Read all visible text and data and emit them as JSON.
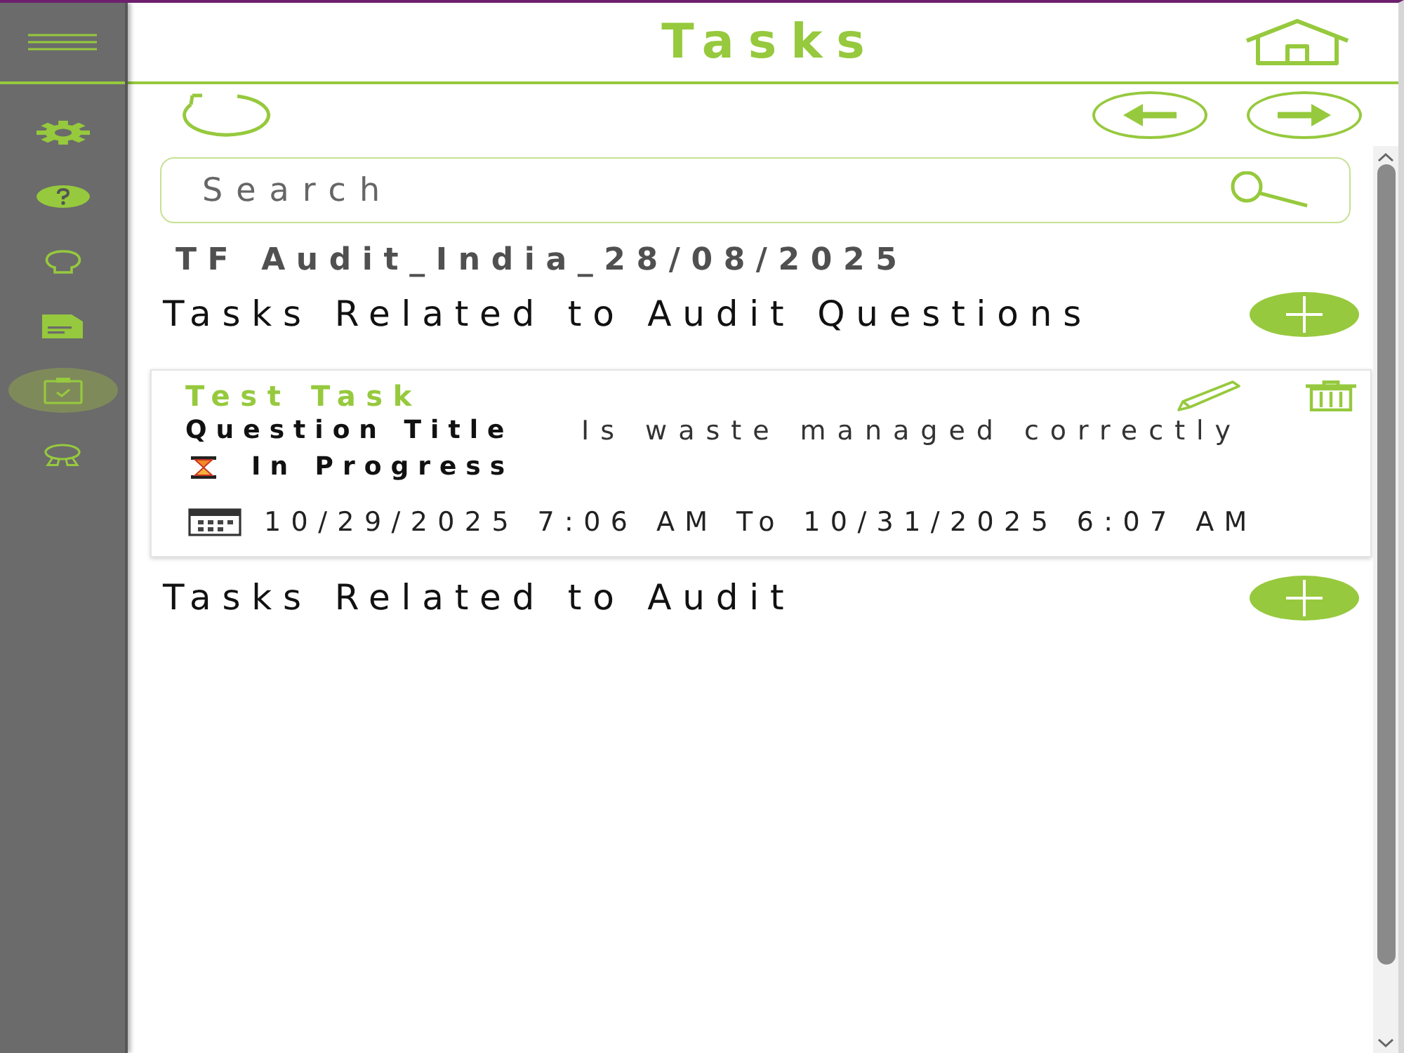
{
  "sidebar": {
    "items": [
      {
        "selected": false
      },
      {
        "selected": false
      },
      {
        "selected": false
      },
      {
        "selected": false
      },
      {
        "selected": true
      },
      {
        "selected": false
      }
    ]
  },
  "header": {
    "title": "Tasks"
  },
  "search": {
    "placeholder": "Search"
  },
  "audit_title": "TF Audit_India_28/08/2025",
  "sections": [
    {
      "heading": "Tasks Related to Audit Questions",
      "tasks": [
        {
          "title": "Test Task",
          "question_label": "Question Title",
          "question_value": "Is waste managed correctly",
          "status": "In Progress",
          "date_range": "10/29/2025 7:06 AM To 10/31/2025 6:07 AM"
        }
      ]
    },
    {
      "heading": "Tasks Related to Audit"
    }
  ]
}
